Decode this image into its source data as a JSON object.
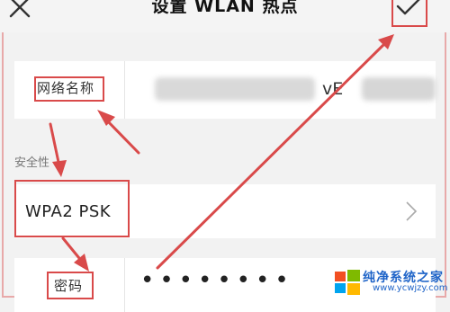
{
  "header": {
    "title": "设置 WLAN 热点",
    "close_icon": "close-icon",
    "confirm_icon": "check-icon"
  },
  "network_name": {
    "label": "网络名称",
    "visible_value_fragment": "vE"
  },
  "security": {
    "section_label": "安全性",
    "value": "WPA2 PSK",
    "chevron_icon": "chevron-right-icon"
  },
  "password": {
    "label": "密码",
    "masked_value": "••••••••"
  },
  "watermark": {
    "line1": "纯净系统之家",
    "line2": "www.ycwjzy.com"
  },
  "colors": {
    "annotation": "#d94a4a",
    "background": "#f2f2f2",
    "card": "#ffffff",
    "watermark": "#1f64c8"
  }
}
